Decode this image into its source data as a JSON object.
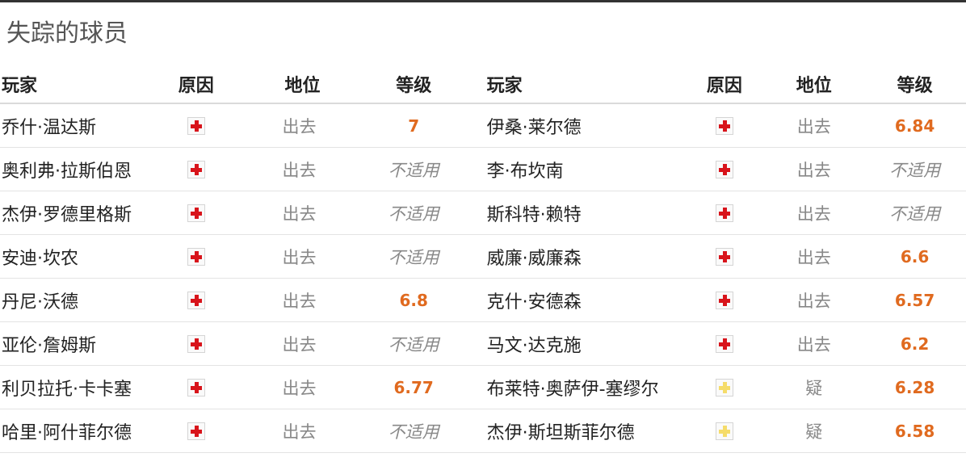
{
  "title": "失踪的球员",
  "colors": {
    "rating": "#e06a1f",
    "injury_cross": "#d8141b",
    "doubtful_cross": "#f5dc6a"
  },
  "headers": {
    "player": "玩家",
    "reason": "原因",
    "status": "地位",
    "rating": "等级"
  },
  "left": [
    {
      "name": "乔什·温达斯",
      "icon": "injury-red-cross-icon",
      "status": "出去",
      "rating": "7",
      "rated": true
    },
    {
      "name": "奥利弗·拉斯伯恩",
      "icon": "injury-red-cross-icon",
      "status": "出去",
      "rating": "不适用",
      "rated": false
    },
    {
      "name": "杰伊·罗德里格斯",
      "icon": "injury-red-cross-icon",
      "status": "出去",
      "rating": "不适用",
      "rated": false
    },
    {
      "name": "安迪·坎农",
      "icon": "injury-red-cross-icon",
      "status": "出去",
      "rating": "不适用",
      "rated": false
    },
    {
      "name": "丹尼·沃德",
      "icon": "injury-red-cross-icon",
      "status": "出去",
      "rating": "6.8",
      "rated": true
    },
    {
      "name": "亚伦·詹姆斯",
      "icon": "injury-red-cross-icon",
      "status": "出去",
      "rating": "不适用",
      "rated": false
    },
    {
      "name": "利贝拉托·卡卡塞",
      "icon": "injury-red-cross-icon",
      "status": "出去",
      "rating": "6.77",
      "rated": true
    },
    {
      "name": "哈里·阿什菲尔德",
      "icon": "injury-red-cross-icon",
      "status": "出去",
      "rating": "不适用",
      "rated": false
    }
  ],
  "right": [
    {
      "name": "伊桑·莱尔德",
      "icon": "injury-red-cross-icon",
      "status": "出去",
      "rating": "6.84",
      "rated": true
    },
    {
      "name": "李·布坎南",
      "icon": "injury-red-cross-icon",
      "status": "出去",
      "rating": "不适用",
      "rated": false
    },
    {
      "name": "斯科特·赖特",
      "icon": "injury-red-cross-icon",
      "status": "出去",
      "rating": "不适用",
      "rated": false
    },
    {
      "name": "威廉·威廉森",
      "icon": "injury-red-cross-icon",
      "status": "出去",
      "rating": "6.6",
      "rated": true
    },
    {
      "name": "克什·安德森",
      "icon": "injury-red-cross-icon",
      "status": "出去",
      "rating": "6.57",
      "rated": true
    },
    {
      "name": "马文·达克施",
      "icon": "injury-red-cross-icon",
      "status": "出去",
      "rating": "6.2",
      "rated": true
    },
    {
      "name": "布莱特·奥萨伊-塞缪尔",
      "icon": "doubtful-yellow-cross-icon",
      "status": "疑",
      "rating": "6.28",
      "rated": true
    },
    {
      "name": "杰伊·斯坦斯菲尔德",
      "icon": "doubtful-yellow-cross-icon",
      "status": "疑",
      "rating": "6.58",
      "rated": true
    }
  ]
}
